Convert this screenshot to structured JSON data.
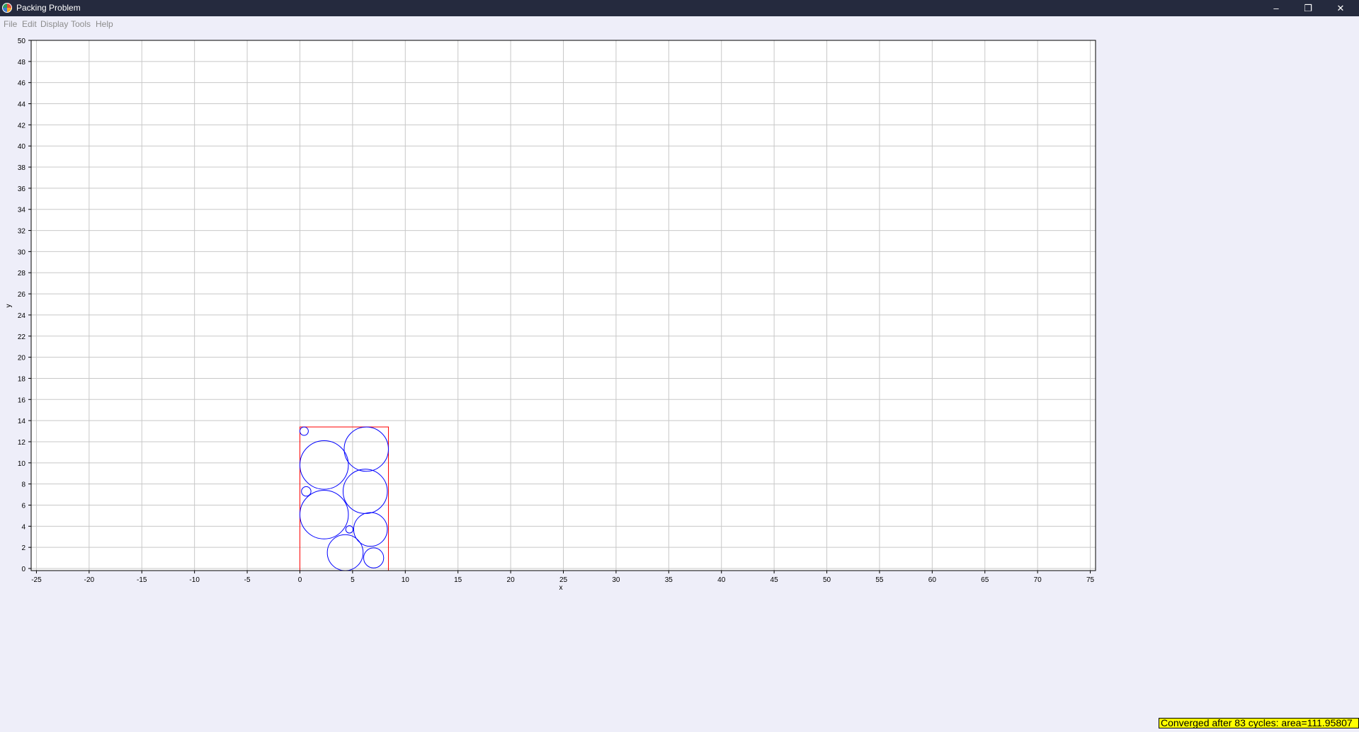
{
  "window": {
    "title": "Packing Problem",
    "controls": {
      "minimize": "–",
      "restore": "❐",
      "close": "✕"
    }
  },
  "menu": {
    "items": [
      {
        "label": "File"
      },
      {
        "label": "Edit"
      },
      {
        "label": "Display"
      },
      {
        "label": "Tools"
      },
      {
        "label": "Help"
      }
    ]
  },
  "chart_data": {
    "type": "scatter",
    "xlabel": "x",
    "ylabel": "y",
    "xlim": [
      -25.5,
      75.5
    ],
    "ylim": [
      -0.2,
      50
    ],
    "x_ticks": [
      -25,
      -20,
      -15,
      -10,
      -5,
      0,
      5,
      10,
      15,
      20,
      25,
      30,
      35,
      40,
      45,
      50,
      55,
      60,
      65,
      70,
      75
    ],
    "y_ticks": [
      0,
      2,
      4,
      6,
      8,
      10,
      12,
      14,
      16,
      18,
      20,
      22,
      24,
      26,
      28,
      30,
      32,
      34,
      36,
      38,
      40,
      42,
      44,
      46,
      48,
      50
    ],
    "grid": true,
    "container": {
      "x": [
        0,
        8.4
      ],
      "y": [
        -0.2,
        13.4
      ],
      "color": "#ff0000"
    },
    "circle_color": "#0000ff",
    "circles": [
      {
        "cx": 0.4,
        "cy": 13.0,
        "r": 0.4
      },
      {
        "cx": 6.3,
        "cy": 11.3,
        "r": 2.1
      },
      {
        "cx": 2.3,
        "cy": 9.8,
        "r": 2.3
      },
      {
        "cx": 6.2,
        "cy": 7.3,
        "r": 2.1
      },
      {
        "cx": 0.6,
        "cy": 7.3,
        "r": 0.45
      },
      {
        "cx": 2.3,
        "cy": 5.1,
        "r": 2.3
      },
      {
        "cx": 6.7,
        "cy": 3.7,
        "r": 1.6
      },
      {
        "cx": 4.7,
        "cy": 3.7,
        "r": 0.35
      },
      {
        "cx": 4.3,
        "cy": 1.5,
        "r": 1.7
      },
      {
        "cx": 7.0,
        "cy": 1.0,
        "r": 0.95
      }
    ]
  },
  "status": {
    "text": "Converged after 83 cycles: area=111.95807",
    "background": "#ffff00"
  }
}
